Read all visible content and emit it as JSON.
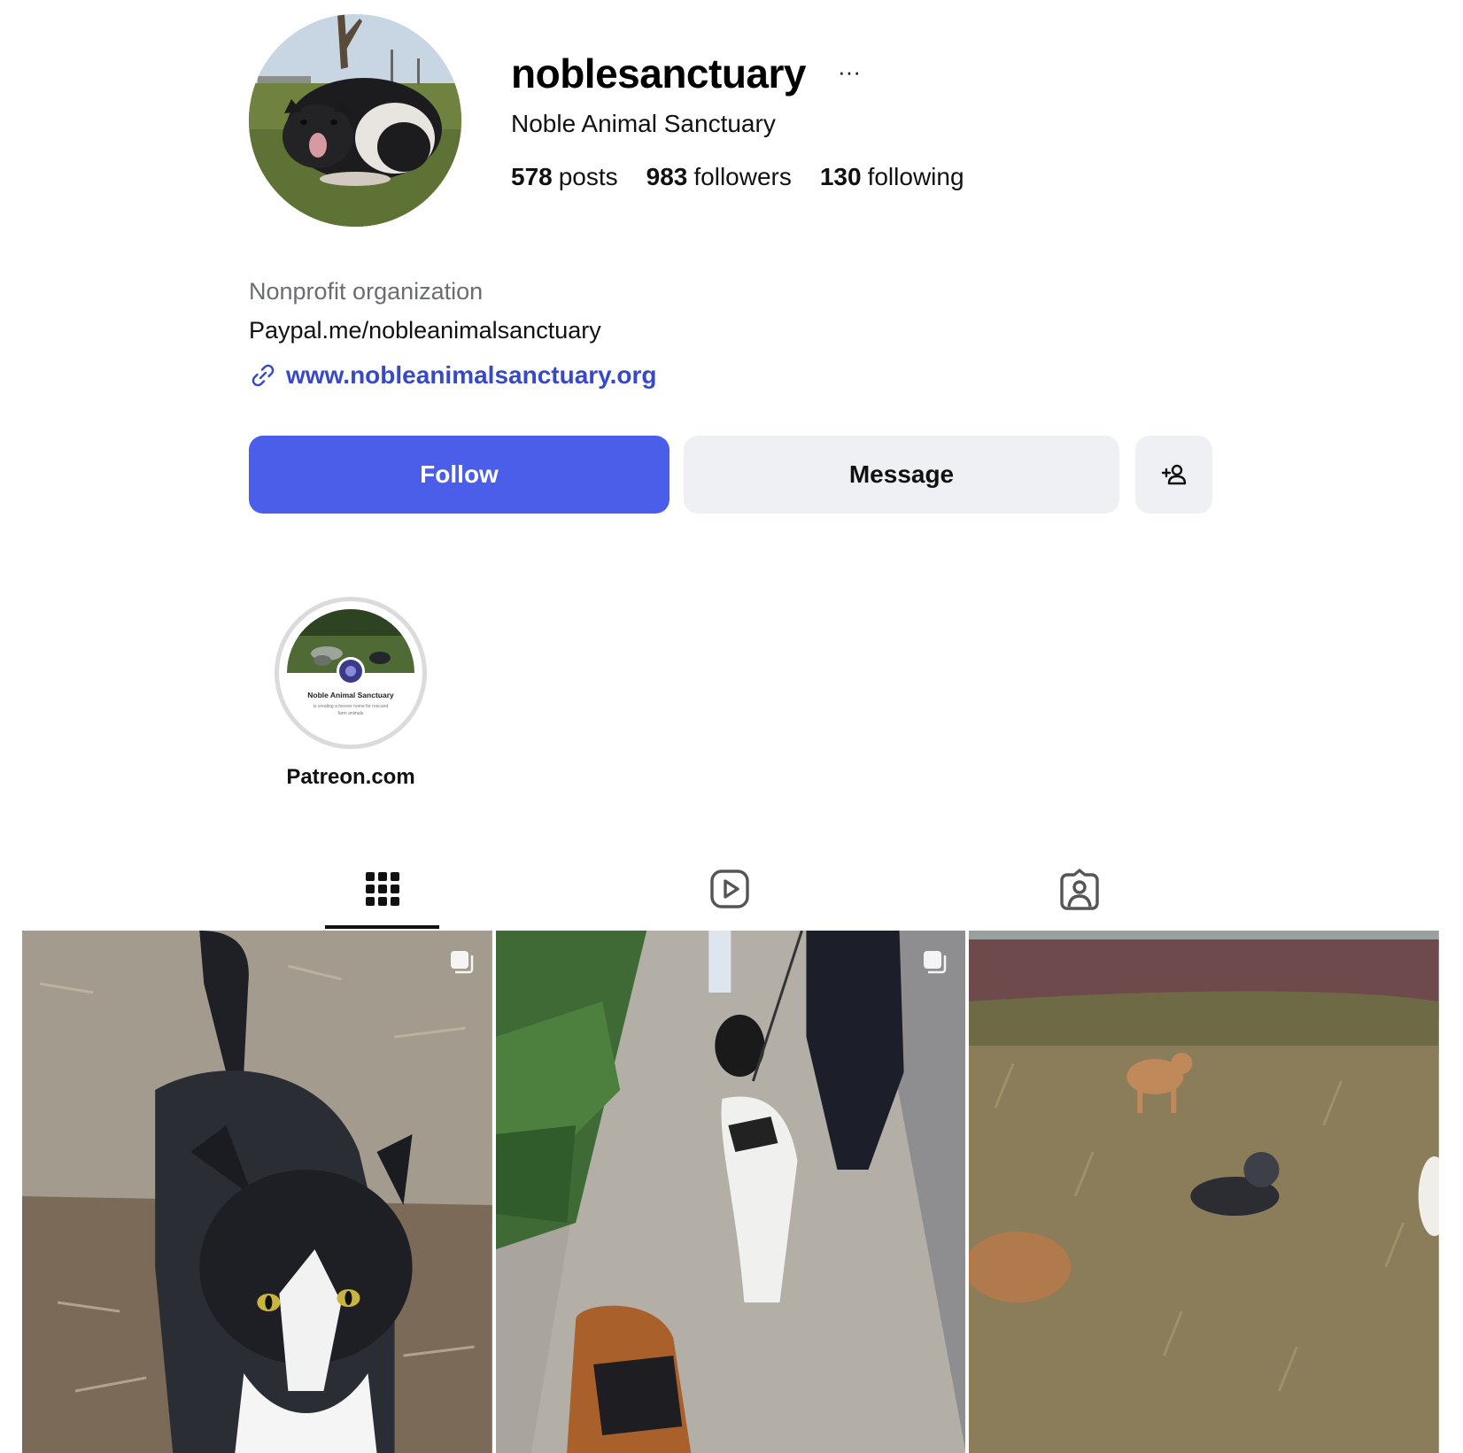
{
  "profile": {
    "username": "noblesanctuary",
    "full_name": "Noble Animal Sanctuary",
    "more_icon": "···",
    "stats": [
      {
        "num": "578",
        "label": "posts"
      },
      {
        "num": "983",
        "label": "followers"
      },
      {
        "num": "130",
        "label": "following"
      }
    ],
    "category": "Nonprofit organization",
    "bio": "Paypal.me/nobleanimalsanctuary",
    "website": "www.nobleanimalsanctuary.org",
    "link_color": "#3849c8"
  },
  "actions": {
    "follow_label": "Follow",
    "message_label": "Message",
    "add_user_icon": "person-add-icon",
    "follow_color": "#4a5eea",
    "secondary_color": "#eff0f3"
  },
  "highlights": [
    {
      "label": "Patreon.com",
      "cover_title": "Noble Animal Sanctuary",
      "cover_subtitle_1": "is creating a forever home for rescued",
      "cover_subtitle_2": "farm animals"
    }
  ],
  "tabs": [
    {
      "icon": "grid-icon",
      "active": true
    },
    {
      "icon": "reels-icon",
      "active": false
    },
    {
      "icon": "tagged-icon",
      "active": false
    }
  ],
  "posts": [
    {
      "subject": "black-and-white cat",
      "multi": true
    },
    {
      "subject": "people walking dogs on sidewalk",
      "multi": true
    },
    {
      "subject": "dogs in a grassy field",
      "multi": false
    }
  ]
}
